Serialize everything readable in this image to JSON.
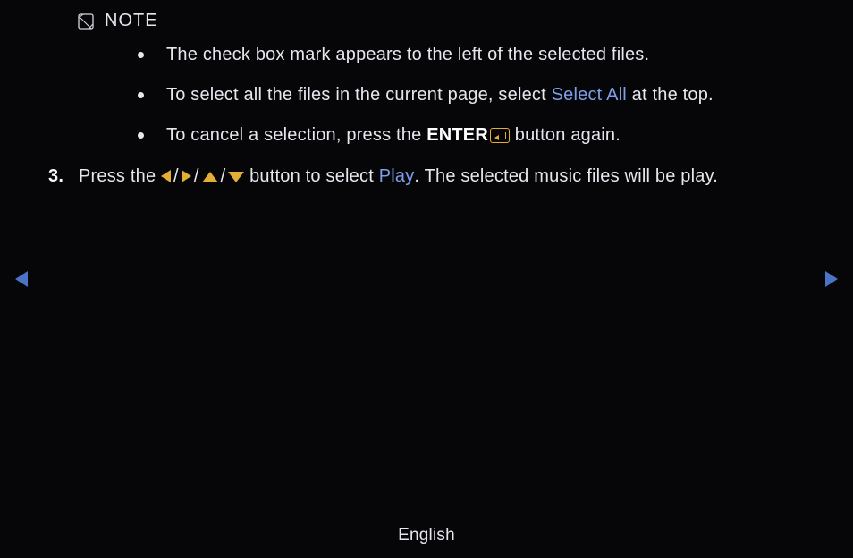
{
  "note": {
    "label": "NOTE"
  },
  "bullets": {
    "b1": "The check box mark appears to the left of the selected files.",
    "b2_pre": "To select all the files in the current page, select ",
    "b2_select_all": "Select All",
    "b2_post": " at the top.",
    "b3_pre": "To cancel a selection, press the ",
    "b3_enter": "ENTER",
    "b3_post": " button again."
  },
  "step3": {
    "number": "3.",
    "pre": "Press the ",
    "sep": " / ",
    "mid": " button to select ",
    "play": "Play",
    "post": ". The selected music files will be play."
  },
  "footer": {
    "lang": "English"
  }
}
